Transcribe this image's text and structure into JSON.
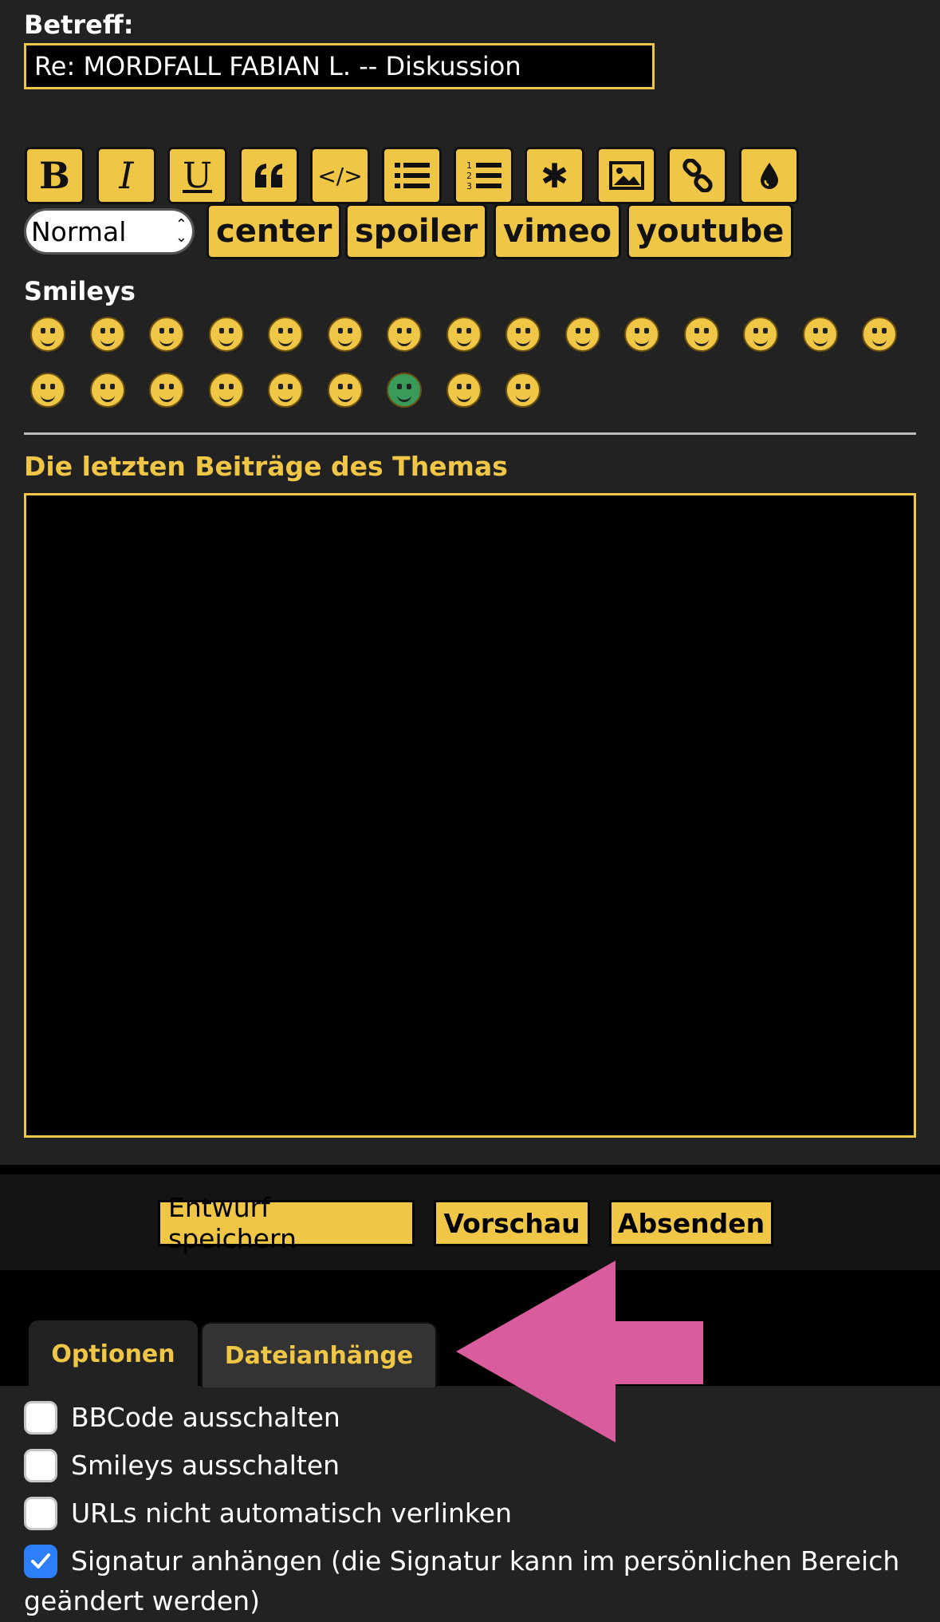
{
  "subject": {
    "label": "Betreff:",
    "value": "Re: MORDFALL FABIAN L. -- Diskussion"
  },
  "toolbar": {
    "row1": [
      {
        "icon": "bold-icon",
        "glyph": "B"
      },
      {
        "icon": "italic-icon",
        "glyph": "I"
      },
      {
        "icon": "underline-icon",
        "glyph": "U"
      },
      {
        "icon": "quote-icon",
        "glyph": "“"
      },
      {
        "icon": "code-icon",
        "glyph": "</>"
      },
      {
        "icon": "list-icon"
      },
      {
        "icon": "numbered-list-icon"
      },
      {
        "icon": "asterisk-icon",
        "glyph": "✱"
      },
      {
        "icon": "image-icon"
      },
      {
        "icon": "link-icon"
      },
      {
        "icon": "color-drop-icon"
      }
    ],
    "size_select": "Normal",
    "row2": [
      "center",
      "spoiler",
      "vimeo",
      "youtube"
    ]
  },
  "smileys": {
    "label": "Smileys",
    "count": 24,
    "colors": {
      "default": "#f0c646",
      "green": "#3a9a5a"
    }
  },
  "recent": {
    "heading": "Die letzten Beiträge des Themas"
  },
  "actions": {
    "save_draft": "Entwurf speichern",
    "preview": "Vorschau",
    "submit": "Absenden"
  },
  "tabs": {
    "options": "Optionen",
    "attachments": "Dateianhänge"
  },
  "options": [
    {
      "label": "BBCode ausschalten",
      "checked": false
    },
    {
      "label": "Smileys ausschalten",
      "checked": false
    },
    {
      "label": "URLs nicht automatisch verlinken",
      "checked": false
    },
    {
      "label": "Signatur anhängen (die Signatur kann im persönlichen Bereich geändert werden)",
      "checked": true
    }
  ],
  "colors": {
    "accent": "#f0c646",
    "panel": "#222222",
    "annotation_arrow": "#d95c9c",
    "checkbox_checked": "#2d7ff9"
  }
}
